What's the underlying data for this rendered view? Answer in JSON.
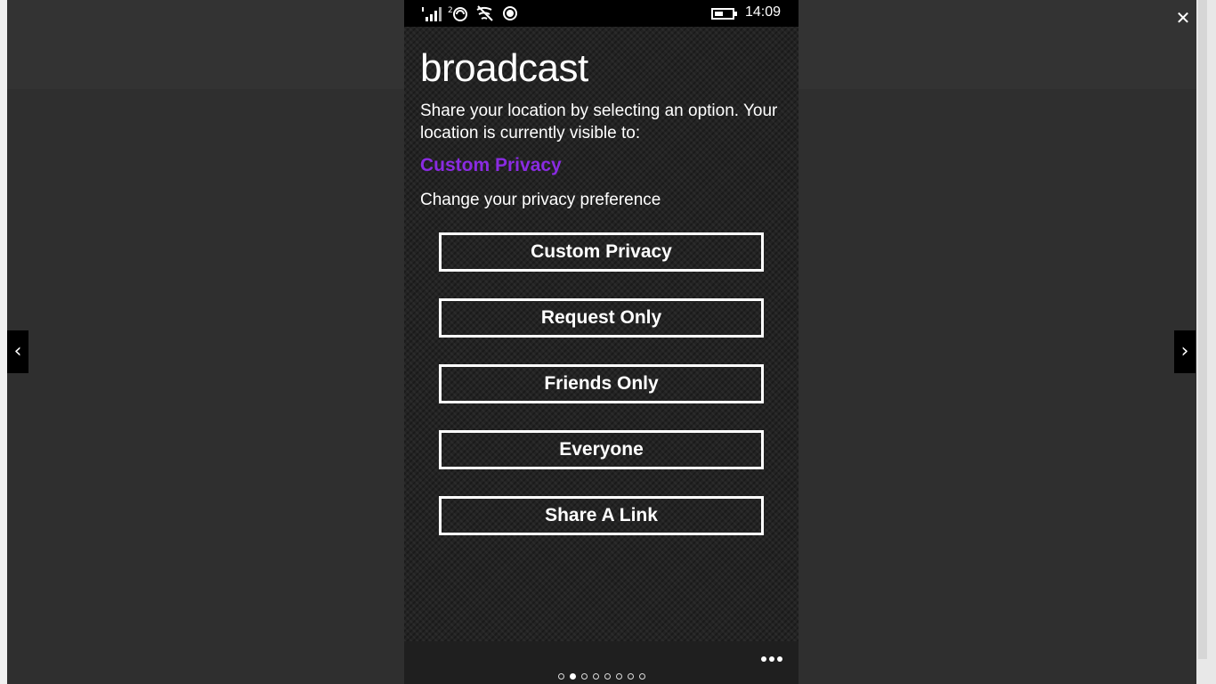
{
  "viewer": {
    "close_symbol": "✕",
    "prev_symbol": "‹",
    "next_symbol": "›"
  },
  "status_bar": {
    "time": "14:09",
    "icons": [
      "signal-strength-icon",
      "sim-2-icon",
      "wifi-icon",
      "record-icon",
      "battery-icon"
    ]
  },
  "screen": {
    "title": "broadcast",
    "intro": "Share your location by selecting an option. Your location is currently visible to:",
    "current_privacy": "Custom Privacy",
    "current_privacy_color": "#8a2be2",
    "change_prompt": "Change your privacy preference",
    "options": [
      {
        "label": "Custom Privacy"
      },
      {
        "label": "Request Only"
      },
      {
        "label": "Friends Only"
      },
      {
        "label": "Everyone"
      },
      {
        "label": "Share A Link"
      }
    ]
  },
  "pager": {
    "total_pages": 8,
    "active_page": 2
  }
}
